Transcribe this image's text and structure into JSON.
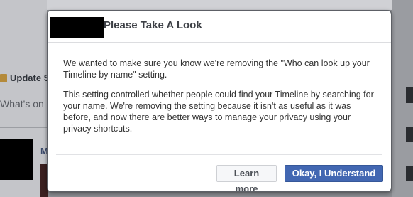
{
  "background": {
    "update_label": "Update S",
    "whats_on_label": "What's on",
    "name_initial": "M"
  },
  "dialog": {
    "title": "Please Take A Look",
    "paragraph1": "We wanted to make sure you know we're removing the \"Who can look up your Timeline by name\" setting.",
    "paragraph2": "This setting controlled whether people could find your Timeline by searching for your name. We're removing the setting because it isn't as useful as it was before, and now there are better ways to manage your privacy using your privacy shortcuts.",
    "learn_more_label": "Learn more",
    "confirm_label": "Okay, I Understand"
  },
  "colors": {
    "primary_button": "#4267b2",
    "overlay": "#8c8e93"
  }
}
